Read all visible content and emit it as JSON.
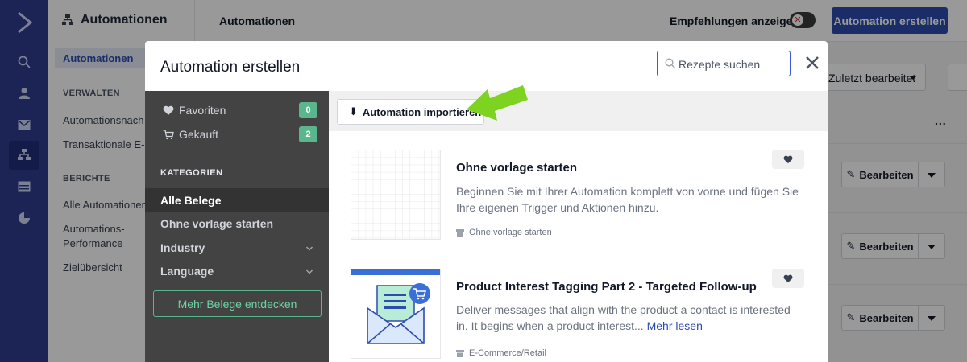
{
  "app": {
    "sidebar": {
      "title": "Automationen",
      "active_item": "Automationen",
      "sections": [
        {
          "heading": "VERWALTEN",
          "items": [
            "Automationsnach",
            "Transaktionale E-M"
          ]
        },
        {
          "heading": "BERICHTE",
          "items": [
            "Alle Automationen",
            "Automations-\nPerformance",
            "Zielübersicht"
          ]
        }
      ]
    },
    "header": {
      "title": "Automationen",
      "recommendations_label": "Empfehlungen anzeigen",
      "create_button": "Automation erstellen"
    },
    "list": {
      "sort_label": "Zuletzt bearbeitet",
      "more_label": "...",
      "edit_label": "Bearbeiten"
    }
  },
  "modal": {
    "title": "Automation erstellen",
    "search_placeholder": "Rezepte suchen",
    "left": {
      "favorites_label": "Favoriten",
      "favorites_count": "0",
      "purchased_label": "Gekauft",
      "purchased_count": "2",
      "categories_heading": "KATEGORIEN",
      "categories": [
        "Alle Belege",
        "Ohne vorlage starten",
        "Industry",
        "Language"
      ],
      "selected_category": "Alle Belege",
      "discover_button": "Mehr Belege entdecken"
    },
    "import_button": "Automation importieren",
    "recipes": [
      {
        "title": "Ohne vorlage starten",
        "description": "Beginnen Sie mit Ihrer Automation komplett von vorne und fügen Sie Ihre eigenen Trigger und Aktionen hinzu.",
        "tag": "Ohne vorlage starten"
      },
      {
        "title": "Product Interest Tagging Part 2 - Targeted Follow-up",
        "description": "Deliver messages that align with the product a contact is interested in. It begins when a product interest...",
        "read_more": "Mehr lesen",
        "tag": "E-Commerce/Retail"
      }
    ]
  },
  "colors": {
    "brand_blue": "#2d4bb0",
    "rail_blue": "#2d3c8e",
    "green_badge": "#5ab68c",
    "arrow_green": "#7ed321"
  }
}
